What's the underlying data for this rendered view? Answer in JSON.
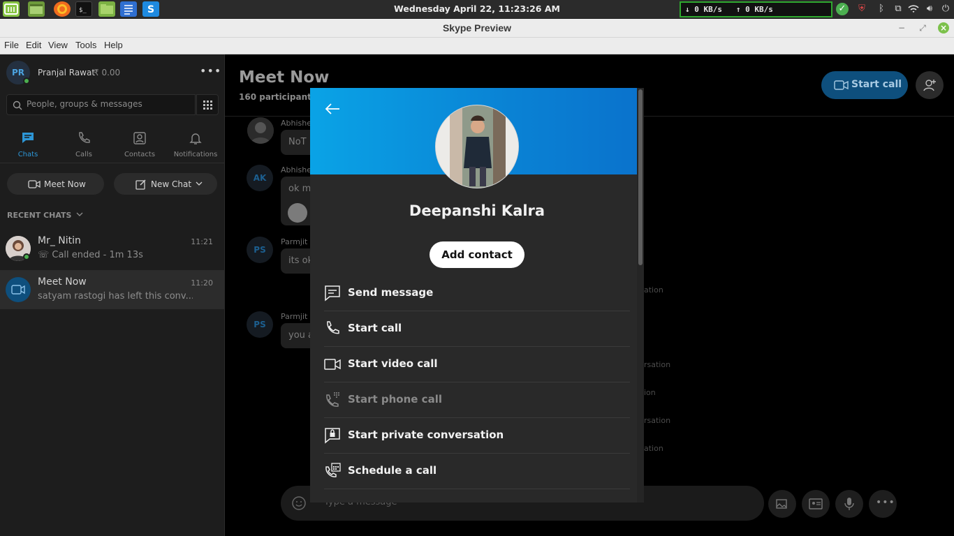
{
  "taskbar": {
    "apps": [
      "mint-menu-icon",
      "desktop-icon",
      "firefox-icon",
      "terminal-icon",
      "files-icon",
      "text-editor-icon",
      "skype-icon"
    ],
    "clock": "Wednesday April 22, 11:23:26 AM",
    "net_down": "↓ 0 KB/s",
    "net_up": "↑ 0 KB/s"
  },
  "window": {
    "title": "Skype Preview"
  },
  "menu": {
    "items": [
      "File",
      "Edit",
      "View",
      "Tools",
      "Help"
    ]
  },
  "profile": {
    "initials": "PR",
    "name": "Pranjal Rawat",
    "credit": "₹ 0.00"
  },
  "search": {
    "placeholder": "People, groups & messages"
  },
  "nav": {
    "tabs": [
      {
        "label": "Chats",
        "icon": "chat-icon",
        "active": true
      },
      {
        "label": "Calls",
        "icon": "phone-icon"
      },
      {
        "label": "Contacts",
        "icon": "contacts-icon"
      },
      {
        "label": "Notifications",
        "icon": "bell-icon"
      }
    ]
  },
  "actions": {
    "meet_now": "Meet Now",
    "new_chat": "New Chat"
  },
  "recent": {
    "header": "RECENT CHATS",
    "chats": [
      {
        "name": "Mr_ Nitin",
        "time": "11:21",
        "preview": "Call ended - 1m 13s"
      },
      {
        "name": "Meet Now",
        "time": "11:20",
        "preview": "satyam rastogi has left this conv..."
      }
    ]
  },
  "conversation": {
    "title": "Meet Now",
    "subtitle": "160 participants",
    "start_call": "Start call",
    "messages": [
      {
        "sender": "Abhishe",
        "initials": "",
        "text": "NoT"
      },
      {
        "sender": "Abhishe",
        "initials": "AK",
        "text": "ok m"
      },
      {
        "sender": "Parmjit",
        "initials": "PS",
        "text": "its ok"
      },
      {
        "sender": "Parmjit",
        "initials": "PS",
        "text": "you a"
      }
    ],
    "system_fragments": [
      "ation",
      "rsation",
      "ion",
      "rsation",
      "ation"
    ],
    "compose_placeholder": "Type a message"
  },
  "modal": {
    "name": "Deepanshi Kalra",
    "add_contact": "Add contact",
    "actions": [
      {
        "label": "Send message",
        "icon": "message-icon",
        "enabled": true
      },
      {
        "label": "Start call",
        "icon": "phone-icon",
        "enabled": true
      },
      {
        "label": "Start video call",
        "icon": "video-icon",
        "enabled": true
      },
      {
        "label": "Start phone call",
        "icon": "dialpad-phone-icon",
        "enabled": false
      },
      {
        "label": "Start private conversation",
        "icon": "lock-chat-icon",
        "enabled": true
      },
      {
        "label": "Schedule a call",
        "icon": "schedule-call-icon",
        "enabled": true
      }
    ]
  },
  "colors": {
    "accent": "#0a8dd8",
    "sidebar_bg": "#1d1d1d",
    "presence_online": "#4caf50"
  }
}
